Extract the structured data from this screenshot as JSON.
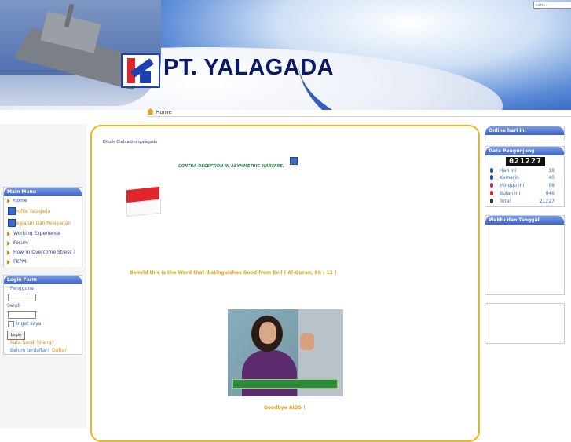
{
  "header": {
    "brand": "PT. YALAGADA",
    "search_placeholder": "cari..."
  },
  "breadcrumb": {
    "home": "Home"
  },
  "main_menu": {
    "title": "Main Menu",
    "items": [
      {
        "label": "Home"
      },
      {
        "label": "Profile Yalagada"
      },
      {
        "label": "Kegiatan Dan Pelayanan"
      },
      {
        "label": "Working Experience"
      },
      {
        "label": "Forum"
      },
      {
        "label": "How To Overcome Stress ?"
      },
      {
        "label": "FKPM"
      }
    ]
  },
  "login": {
    "title": "Login Form",
    "username_label": "Pengguna",
    "password_label": "Sandi",
    "remember_label": "Ingat saya",
    "button_label": "Login",
    "forgot_label": "Kata Sandi hilang?",
    "register_prompt": "Belum terdaftar?",
    "register_link": "Daftar"
  },
  "article": {
    "author": "Ditulis Oleh adminyalagada",
    "headline": "CONTRA-DECEPTION IN ASYMMETRIC WARFARE.",
    "quote": "Behold this is the Word that distinguishes Good from Evil  (  Al-Quran, 86 ;  13  )",
    "caption": "Goodbye AIDS  !"
  },
  "online": {
    "title": "Online hari ini"
  },
  "visitors": {
    "title": "Data Pengunjung",
    "counter": "021227",
    "rows": [
      {
        "label": "Hari ini",
        "value": "18",
        "color": "#2a4f9e"
      },
      {
        "label": "Kemarin",
        "value": "40",
        "color": "#2a4f9e"
      },
      {
        "label": "Minggu ini",
        "value": "98",
        "color": "#b03070"
      },
      {
        "label": "Bulan ini",
        "value": "946",
        "color": "#c83030"
      },
      {
        "label": "Total",
        "value": "21227",
        "color": "#333333"
      }
    ]
  },
  "clock": {
    "title": "Waktu dan Tanggal"
  },
  "colors": {
    "accent": "#f2b21a",
    "link": "#3d6cc8",
    "header_blue": "#3f65c8"
  }
}
